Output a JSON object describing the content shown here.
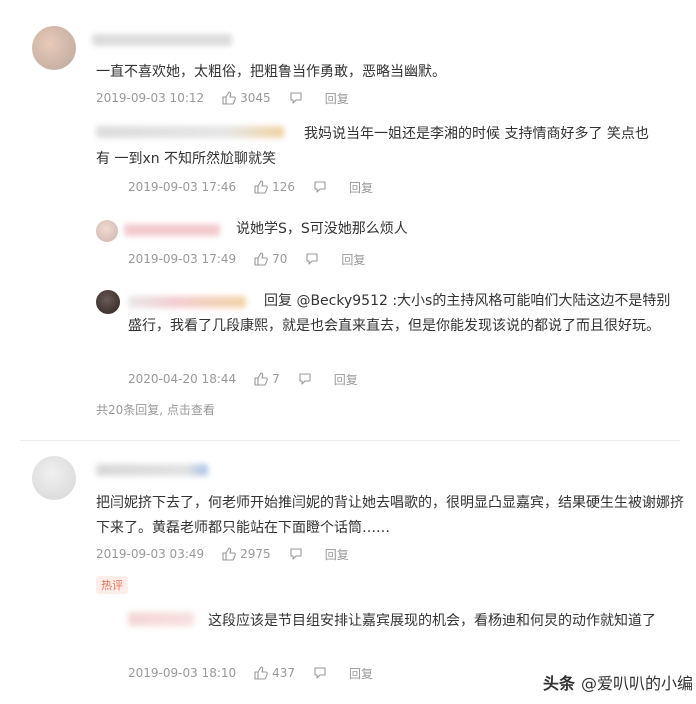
{
  "comments": [
    {
      "text": "一直不喜欢她，太粗俗，把粗鲁当作勇敢，恶略当幽默。",
      "time": "2019-09-03 10:12",
      "likes": "3045",
      "reply_label": "回复",
      "replies": [
        {
          "text": "我妈说当年一姐还是李湘的时候 支持情商好多了  笑点也有  一到xn 不知所然尬聊就笑",
          "time": "2019-09-03 17:46",
          "likes": "126",
          "reply_label": "回复"
        },
        {
          "text": "说她学S，S可没她那么烦人",
          "time": "2019-09-03 17:49",
          "likes": "70",
          "reply_label": "回复"
        },
        {
          "text": "回复 @Becky9512 :大小s的主持风格可能咱们大陆这边不是特别盛行，我看了几段康熙，就是也会直来直去，但是你能发现该说的都说了而且很好玩。",
          "time": "2020-04-20 18:44",
          "likes": "7",
          "reply_label": "回复"
        }
      ],
      "more_replies": "共20条回复, 点击查看"
    },
    {
      "text": "把闫妮挤下去了，何老师开始推闫妮的背让她去唱歌的，很明显凸显嘉宾，结果硬生生被谢娜挤下来了。黄磊老师都只能站在下面瞪个话筒……",
      "time": "2019-09-03 03:49",
      "likes": "2975",
      "reply_label": "回复",
      "badge": "热评",
      "replies": [
        {
          "text": "这段应该是节目组安排让嘉宾展现的机会，看杨迪和何炅的动作就知道了",
          "time": "2019-09-03 18:10",
          "likes": "437",
          "reply_label": "回复"
        }
      ]
    }
  ],
  "watermark": {
    "brand": "头条",
    "handle": "@爱叭叭的小编"
  },
  "colors": {
    "text": "#333333",
    "meta": "#999999",
    "badge_text": "#e8735b",
    "badge_bg": "#fdeee9",
    "divider": "#ececec"
  }
}
